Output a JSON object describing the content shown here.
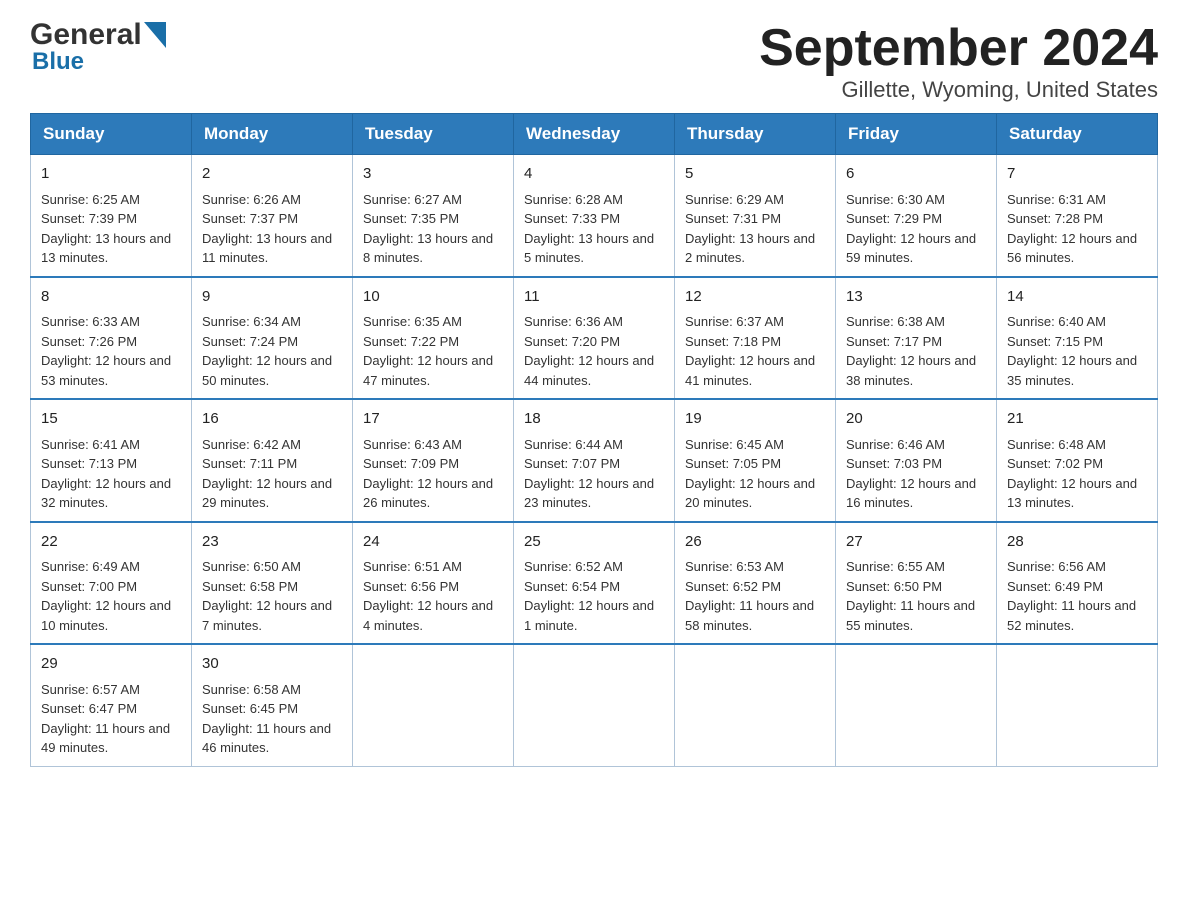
{
  "logo": {
    "general": "General",
    "blue": "Blue"
  },
  "title": "September 2024",
  "subtitle": "Gillette, Wyoming, United States",
  "weekdays": [
    "Sunday",
    "Monday",
    "Tuesday",
    "Wednesday",
    "Thursday",
    "Friday",
    "Saturday"
  ],
  "weeks": [
    [
      {
        "day": "1",
        "sunrise": "Sunrise: 6:25 AM",
        "sunset": "Sunset: 7:39 PM",
        "daylight": "Daylight: 13 hours and 13 minutes."
      },
      {
        "day": "2",
        "sunrise": "Sunrise: 6:26 AM",
        "sunset": "Sunset: 7:37 PM",
        "daylight": "Daylight: 13 hours and 11 minutes."
      },
      {
        "day": "3",
        "sunrise": "Sunrise: 6:27 AM",
        "sunset": "Sunset: 7:35 PM",
        "daylight": "Daylight: 13 hours and 8 minutes."
      },
      {
        "day": "4",
        "sunrise": "Sunrise: 6:28 AM",
        "sunset": "Sunset: 7:33 PM",
        "daylight": "Daylight: 13 hours and 5 minutes."
      },
      {
        "day": "5",
        "sunrise": "Sunrise: 6:29 AM",
        "sunset": "Sunset: 7:31 PM",
        "daylight": "Daylight: 13 hours and 2 minutes."
      },
      {
        "day": "6",
        "sunrise": "Sunrise: 6:30 AM",
        "sunset": "Sunset: 7:29 PM",
        "daylight": "Daylight: 12 hours and 59 minutes."
      },
      {
        "day": "7",
        "sunrise": "Sunrise: 6:31 AM",
        "sunset": "Sunset: 7:28 PM",
        "daylight": "Daylight: 12 hours and 56 minutes."
      }
    ],
    [
      {
        "day": "8",
        "sunrise": "Sunrise: 6:33 AM",
        "sunset": "Sunset: 7:26 PM",
        "daylight": "Daylight: 12 hours and 53 minutes."
      },
      {
        "day": "9",
        "sunrise": "Sunrise: 6:34 AM",
        "sunset": "Sunset: 7:24 PM",
        "daylight": "Daylight: 12 hours and 50 minutes."
      },
      {
        "day": "10",
        "sunrise": "Sunrise: 6:35 AM",
        "sunset": "Sunset: 7:22 PM",
        "daylight": "Daylight: 12 hours and 47 minutes."
      },
      {
        "day": "11",
        "sunrise": "Sunrise: 6:36 AM",
        "sunset": "Sunset: 7:20 PM",
        "daylight": "Daylight: 12 hours and 44 minutes."
      },
      {
        "day": "12",
        "sunrise": "Sunrise: 6:37 AM",
        "sunset": "Sunset: 7:18 PM",
        "daylight": "Daylight: 12 hours and 41 minutes."
      },
      {
        "day": "13",
        "sunrise": "Sunrise: 6:38 AM",
        "sunset": "Sunset: 7:17 PM",
        "daylight": "Daylight: 12 hours and 38 minutes."
      },
      {
        "day": "14",
        "sunrise": "Sunrise: 6:40 AM",
        "sunset": "Sunset: 7:15 PM",
        "daylight": "Daylight: 12 hours and 35 minutes."
      }
    ],
    [
      {
        "day": "15",
        "sunrise": "Sunrise: 6:41 AM",
        "sunset": "Sunset: 7:13 PM",
        "daylight": "Daylight: 12 hours and 32 minutes."
      },
      {
        "day": "16",
        "sunrise": "Sunrise: 6:42 AM",
        "sunset": "Sunset: 7:11 PM",
        "daylight": "Daylight: 12 hours and 29 minutes."
      },
      {
        "day": "17",
        "sunrise": "Sunrise: 6:43 AM",
        "sunset": "Sunset: 7:09 PM",
        "daylight": "Daylight: 12 hours and 26 minutes."
      },
      {
        "day": "18",
        "sunrise": "Sunrise: 6:44 AM",
        "sunset": "Sunset: 7:07 PM",
        "daylight": "Daylight: 12 hours and 23 minutes."
      },
      {
        "day": "19",
        "sunrise": "Sunrise: 6:45 AM",
        "sunset": "Sunset: 7:05 PM",
        "daylight": "Daylight: 12 hours and 20 minutes."
      },
      {
        "day": "20",
        "sunrise": "Sunrise: 6:46 AM",
        "sunset": "Sunset: 7:03 PM",
        "daylight": "Daylight: 12 hours and 16 minutes."
      },
      {
        "day": "21",
        "sunrise": "Sunrise: 6:48 AM",
        "sunset": "Sunset: 7:02 PM",
        "daylight": "Daylight: 12 hours and 13 minutes."
      }
    ],
    [
      {
        "day": "22",
        "sunrise": "Sunrise: 6:49 AM",
        "sunset": "Sunset: 7:00 PM",
        "daylight": "Daylight: 12 hours and 10 minutes."
      },
      {
        "day": "23",
        "sunrise": "Sunrise: 6:50 AM",
        "sunset": "Sunset: 6:58 PM",
        "daylight": "Daylight: 12 hours and 7 minutes."
      },
      {
        "day": "24",
        "sunrise": "Sunrise: 6:51 AM",
        "sunset": "Sunset: 6:56 PM",
        "daylight": "Daylight: 12 hours and 4 minutes."
      },
      {
        "day": "25",
        "sunrise": "Sunrise: 6:52 AM",
        "sunset": "Sunset: 6:54 PM",
        "daylight": "Daylight: 12 hours and 1 minute."
      },
      {
        "day": "26",
        "sunrise": "Sunrise: 6:53 AM",
        "sunset": "Sunset: 6:52 PM",
        "daylight": "Daylight: 11 hours and 58 minutes."
      },
      {
        "day": "27",
        "sunrise": "Sunrise: 6:55 AM",
        "sunset": "Sunset: 6:50 PM",
        "daylight": "Daylight: 11 hours and 55 minutes."
      },
      {
        "day": "28",
        "sunrise": "Sunrise: 6:56 AM",
        "sunset": "Sunset: 6:49 PM",
        "daylight": "Daylight: 11 hours and 52 minutes."
      }
    ],
    [
      {
        "day": "29",
        "sunrise": "Sunrise: 6:57 AM",
        "sunset": "Sunset: 6:47 PM",
        "daylight": "Daylight: 11 hours and 49 minutes."
      },
      {
        "day": "30",
        "sunrise": "Sunrise: 6:58 AM",
        "sunset": "Sunset: 6:45 PM",
        "daylight": "Daylight: 11 hours and 46 minutes."
      },
      null,
      null,
      null,
      null,
      null
    ]
  ]
}
